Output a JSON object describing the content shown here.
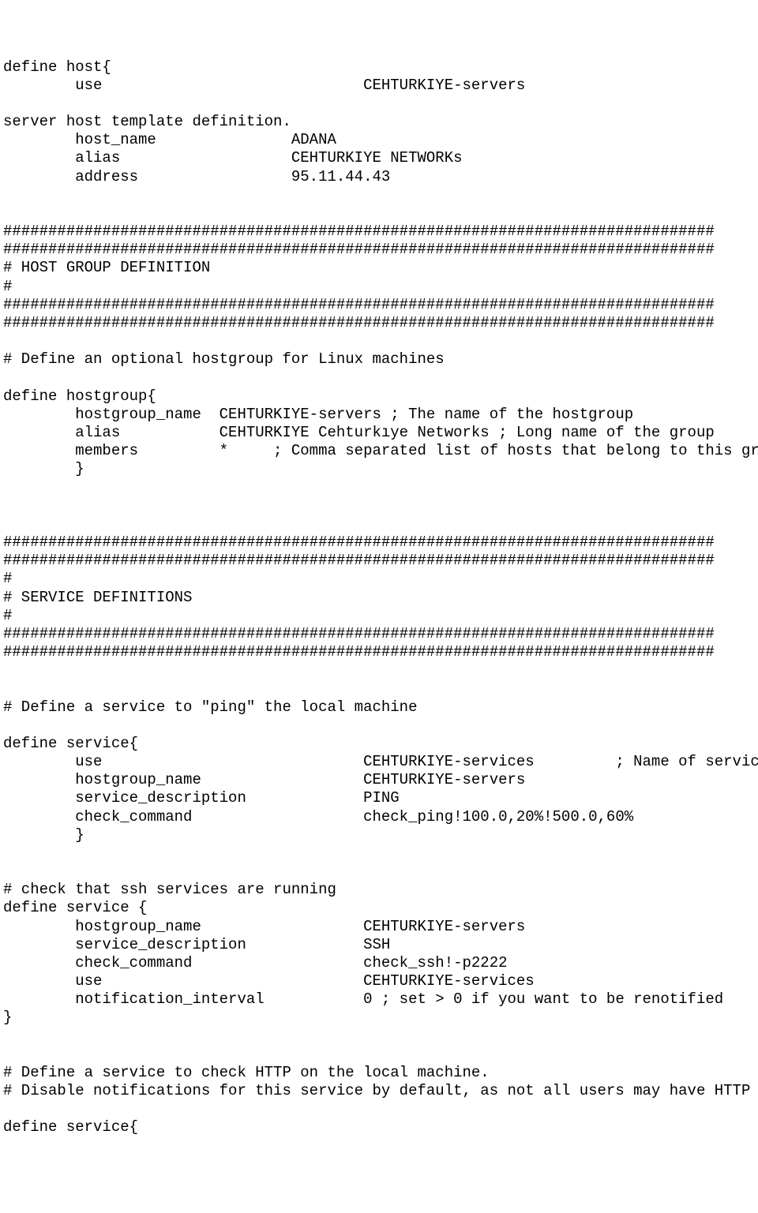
{
  "config_text": "define host{\n        use                             CEHTURKIYE-servers            \n\nserver host template definition.\n        host_name               ADANA\n        alias                   CEHTURKIYE NETWORKs\n        address                 95.11.44.43\n\n\n###############################################################################\n###############################################################################\n# HOST GROUP DEFINITION\n#\n###############################################################################\n###############################################################################\n\n# Define an optional hostgroup for Linux machines\n\ndefine hostgroup{\n        hostgroup_name  CEHTURKIYE-servers ; The name of the hostgroup\n        alias           CEHTURKIYE Cehturkıye Networks ; Long name of the group\n        members         *     ; Comma separated list of hosts that belong to this group\n        }\n\n\n\n###############################################################################\n###############################################################################\n#\n# SERVICE DEFINITIONS\n#\n###############################################################################\n###############################################################################\n\n\n# Define a service to \"ping\" the local machine\n\ndefine service{\n        use                             CEHTURKIYE-services         ; Name of service template to use\n        hostgroup_name                  CEHTURKIYE-servers\n        service_description             PING\n        check_command                   check_ping!100.0,20%!500.0,60%\n        }\n\n\n# check that ssh services are running\ndefine service {\n        hostgroup_name                  CEHTURKIYE-servers\n        service_description             SSH\n        check_command                   check_ssh!-p2222\n        use                             CEHTURKIYE-services\n        notification_interval           0 ; set > 0 if you want to be renotified\n}\n\n\n# Define a service to check HTTP on the local machine.\n# Disable notifications for this service by default, as not all users may have HTTP enabled.\n\ndefine service{"
}
